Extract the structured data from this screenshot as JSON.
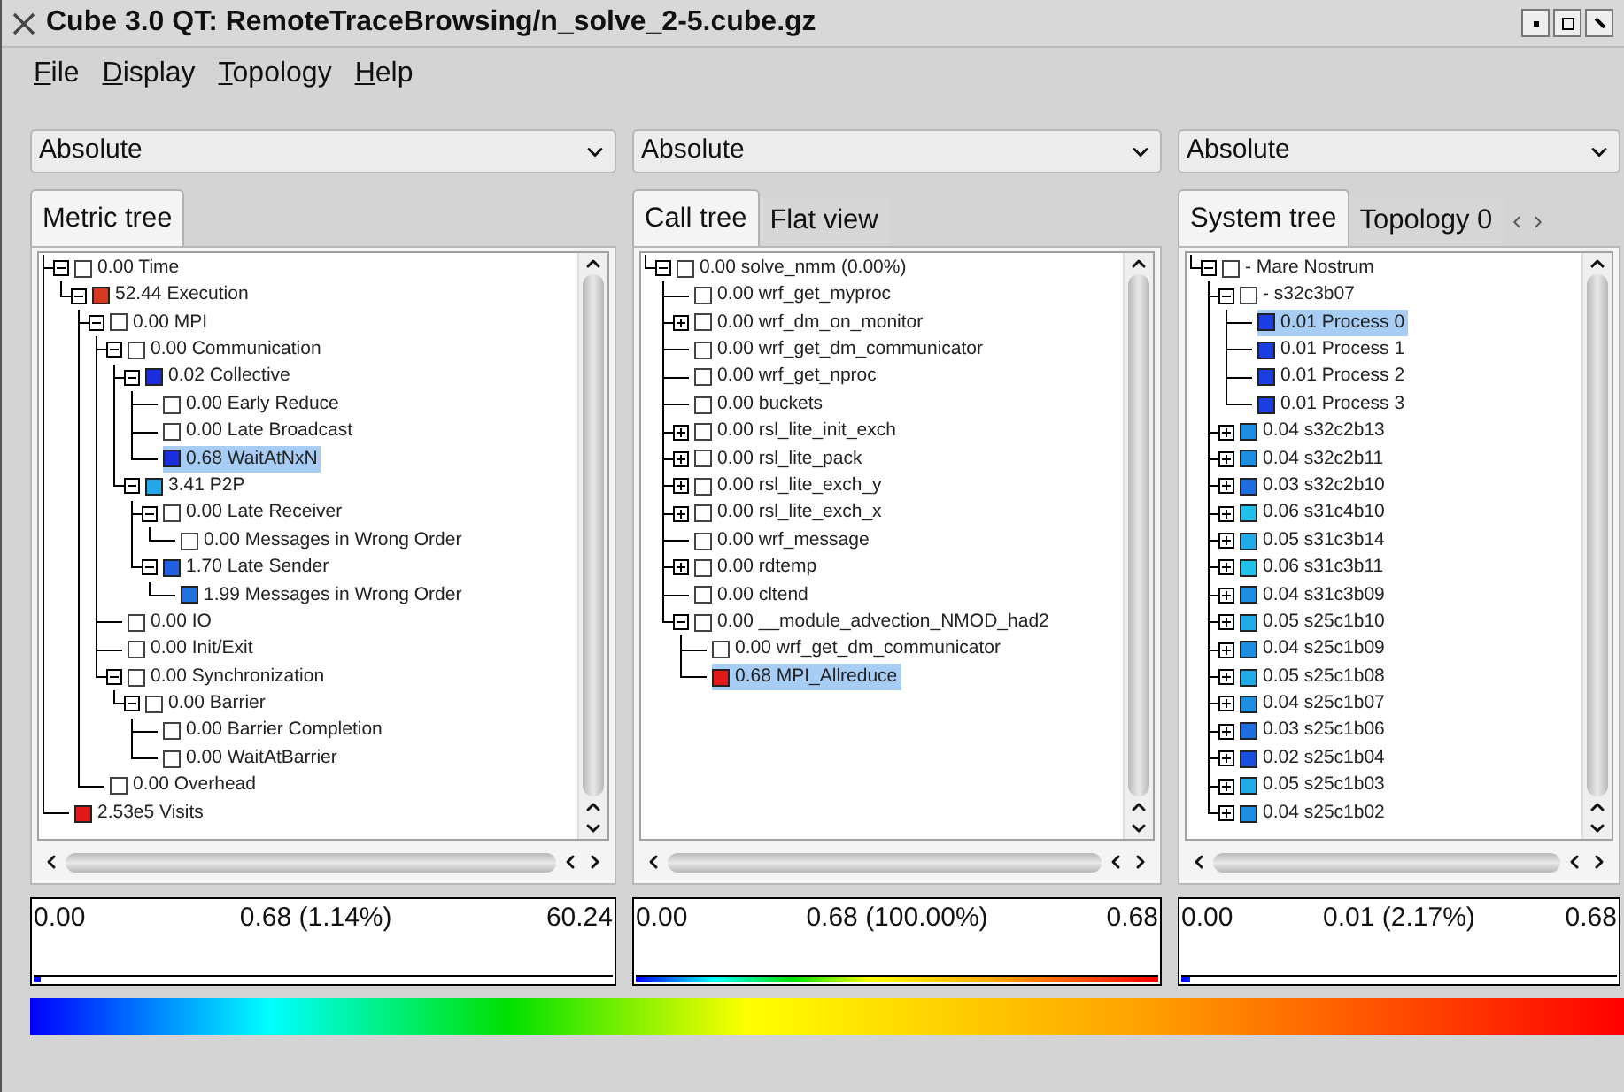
{
  "window": {
    "title": "Cube 3.0 QT: RemoteTraceBrowsing/n_solve_2-5.cube.gz"
  },
  "menu": [
    "File",
    "Display",
    "Topology",
    "Help"
  ],
  "panels": [
    {
      "mode": "Absolute",
      "tabs": [
        {
          "label": "Metric tree",
          "selected": true
        }
      ],
      "tab_arrows": false,
      "tree": [
        {
          "label": "0.00 Time",
          "expanded": true,
          "selected": false,
          "children": [
            {
              "label": "52.44 Execution",
              "color": "#d83a20",
              "expanded": true,
              "selected": false,
              "children": [
                {
                  "label": "0.00 MPI",
                  "expanded": true,
                  "selected": false,
                  "children": [
                    {
                      "label": "0.00 Communication",
                      "expanded": true,
                      "selected": false,
                      "children": [
                        {
                          "label": "0.02 Collective",
                          "color": "#1a2ee0",
                          "expanded": true,
                          "selected": false,
                          "children": [
                            {
                              "label": "0.00 Early Reduce",
                              "selected": false
                            },
                            {
                              "label": "0.00 Late Broadcast",
                              "selected": false
                            },
                            {
                              "label": "0.68 WaitAtNxN",
                              "color": "#1a2ee0",
                              "selected": true
                            }
                          ]
                        },
                        {
                          "label": "3.41 P2P",
                          "color": "#20a8e8",
                          "expanded": true,
                          "selected": false,
                          "children": [
                            {
                              "label": "0.00 Late Receiver",
                              "expanded": true,
                              "selected": false,
                              "children": [
                                {
                                  "label": "0.00 Messages in Wrong Order",
                                  "selected": false
                                }
                              ]
                            },
                            {
                              "label": "1.70 Late Sender",
                              "color": "#2060e0",
                              "expanded": true,
                              "selected": false,
                              "children": [
                                {
                                  "label": "1.99 Messages in Wrong Order",
                                  "color": "#2070e0",
                                  "selected": false
                                }
                              ]
                            }
                          ]
                        }
                      ]
                    },
                    {
                      "label": "0.00 IO",
                      "selected": false
                    },
                    {
                      "label": "0.00 Init/Exit",
                      "selected": false
                    },
                    {
                      "label": "0.00 Synchronization",
                      "expanded": true,
                      "selected": false,
                      "children": [
                        {
                          "label": "0.00 Barrier",
                          "expanded": true,
                          "selected": false,
                          "children": [
                            {
                              "label": "0.00 Barrier Completion",
                              "selected": false
                            },
                            {
                              "label": "0.00 WaitAtBarrier",
                              "selected": false
                            }
                          ]
                        }
                      ]
                    }
                  ]
                },
                {
                  "label": "0.00 Overhead",
                  "selected": false
                }
              ]
            }
          ]
        },
        {
          "label": "2.53e5 Visits",
          "color": "#e01818",
          "selected": false
        }
      ],
      "stats": {
        "min": "0.00",
        "value": "0.68 (1.14%)",
        "max": "60.24"
      },
      "level": 0.0114
    },
    {
      "mode": "Absolute",
      "tabs": [
        {
          "label": "Call tree",
          "selected": true
        },
        {
          "label": "Flat view",
          "selected": false
        }
      ],
      "tab_arrows": false,
      "tree": [
        {
          "label": "0.00 solve_nmm (0.00%)",
          "expanded": true,
          "selected": false,
          "children": [
            {
              "label": "0.00 wrf_get_myproc",
              "selected": false
            },
            {
              "label": "0.00 wrf_dm_on_monitor",
              "expanded": false,
              "selected": false
            },
            {
              "label": "0.00 wrf_get_dm_communicator",
              "selected": false
            },
            {
              "label": "0.00 wrf_get_nproc",
              "selected": false
            },
            {
              "label": "0.00 buckets",
              "selected": false
            },
            {
              "label": "0.00 rsl_lite_init_exch",
              "expanded": false,
              "selected": false
            },
            {
              "label": "0.00 rsl_lite_pack",
              "expanded": false,
              "selected": false
            },
            {
              "label": "0.00 rsl_lite_exch_y",
              "expanded": false,
              "selected": false
            },
            {
              "label": "0.00 rsl_lite_exch_x",
              "expanded": false,
              "selected": false
            },
            {
              "label": "0.00 wrf_message",
              "selected": false
            },
            {
              "label": "0.00 rdtemp",
              "expanded": false,
              "selected": false
            },
            {
              "label": "0.00 cltend",
              "selected": false
            },
            {
              "label": "0.00 __module_advection_NMOD_had2",
              "expanded": true,
              "selected": false,
              "children": [
                {
                  "label": "0.00 wrf_get_dm_communicator",
                  "selected": false
                },
                {
                  "label": "0.68 MPI_Allreduce",
                  "color": "#e01818",
                  "selected": true
                }
              ]
            }
          ]
        }
      ],
      "stats": {
        "min": "0.00",
        "value": "0.68 (100.00%)",
        "max": "0.68"
      },
      "level": 1
    },
    {
      "mode": "Absolute",
      "tabs": [
        {
          "label": "System tree",
          "selected": true
        },
        {
          "label": "Topology 0",
          "selected": false
        }
      ],
      "tab_arrows": true,
      "tree": [
        {
          "label": "- Mare Nostrum",
          "expanded": true,
          "selected": false,
          "children": [
            {
              "label": "- s32c3b07",
              "expanded": true,
              "selected": false,
              "children": [
                {
                  "label": "0.01 Process 0",
                  "color": "#1a3ee0",
                  "selected": true
                },
                {
                  "label": "0.01 Process 1",
                  "color": "#1a3ee0",
                  "selected": false
                },
                {
                  "label": "0.01 Process 2",
                  "color": "#1a3ee0",
                  "selected": false
                },
                {
                  "label": "0.01 Process 3",
                  "color": "#1a3ee0",
                  "selected": false
                }
              ]
            },
            {
              "label": "0.04 s32c2b13",
              "color": "#1e8ee0",
              "expanded": false,
              "selected": false
            },
            {
              "label": "0.04 s32c2b11",
              "color": "#1e8ee0",
              "expanded": false,
              "selected": false
            },
            {
              "label": "0.03 s32c2b10",
              "color": "#1e6ee0",
              "expanded": false,
              "selected": false
            },
            {
              "label": "0.06 s31c4b10",
              "color": "#20c0e8",
              "expanded": false,
              "selected": false
            },
            {
              "label": "0.05 s31c3b14",
              "color": "#20aae8",
              "expanded": false,
              "selected": false
            },
            {
              "label": "0.06 s31c3b11",
              "color": "#20c0e8",
              "expanded": false,
              "selected": false
            },
            {
              "label": "0.04 s31c3b09",
              "color": "#1e8ee0",
              "expanded": false,
              "selected": false
            },
            {
              "label": "0.05 s25c1b10",
              "color": "#20aae8",
              "expanded": false,
              "selected": false
            },
            {
              "label": "0.04 s25c1b09",
              "color": "#1e8ee0",
              "expanded": false,
              "selected": false
            },
            {
              "label": "0.05 s25c1b08",
              "color": "#20aae8",
              "expanded": false,
              "selected": false
            },
            {
              "label": "0.04 s25c1b07",
              "color": "#1e8ee0",
              "expanded": false,
              "selected": false
            },
            {
              "label": "0.03 s25c1b06",
              "color": "#1e6ee0",
              "expanded": false,
              "selected": false
            },
            {
              "label": "0.02 s25c1b04",
              "color": "#1a4ee0",
              "expanded": false,
              "selected": false
            },
            {
              "label": "0.05 s25c1b03",
              "color": "#20aae8",
              "expanded": false,
              "selected": false
            },
            {
              "label": "0.04 s25c1b02",
              "color": "#1e8ee0",
              "expanded": false,
              "selected": false
            }
          ]
        }
      ],
      "stats": {
        "min": "0.00",
        "value": "0.01 (2.17%)",
        "max": "0.68"
      },
      "level": 0.0217
    }
  ]
}
